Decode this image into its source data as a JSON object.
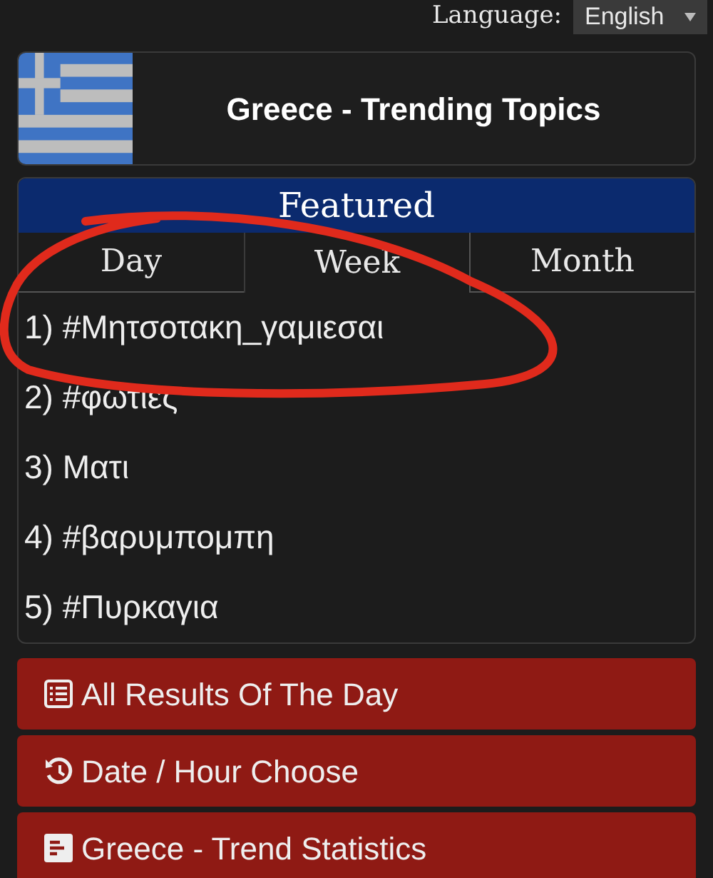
{
  "language": {
    "label": "Language:",
    "value": "English"
  },
  "header": {
    "title": "Greece - Trending Topics"
  },
  "featured": {
    "title": "Featured",
    "tabs": [
      {
        "label": "Day",
        "selected": false
      },
      {
        "label": "Week",
        "selected": true
      },
      {
        "label": "Month",
        "selected": false
      }
    ],
    "topics": [
      {
        "rank": "1)",
        "text": "#Μητσοτακη_γαμιεσαι"
      },
      {
        "rank": "2)",
        "text": "#φωτιες"
      },
      {
        "rank": "3)",
        "text": "Ματι"
      },
      {
        "rank": "4)",
        "text": "#βαρυμπομπη"
      },
      {
        "rank": "5)",
        "text": "#Πυρκαγια"
      }
    ]
  },
  "buttons": [
    {
      "kind": "list",
      "label": "All Results Of The Day"
    },
    {
      "kind": "history",
      "label": "Date / Hour Choose"
    },
    {
      "kind": "stats",
      "label": "Greece - Trend Statistics"
    }
  ]
}
